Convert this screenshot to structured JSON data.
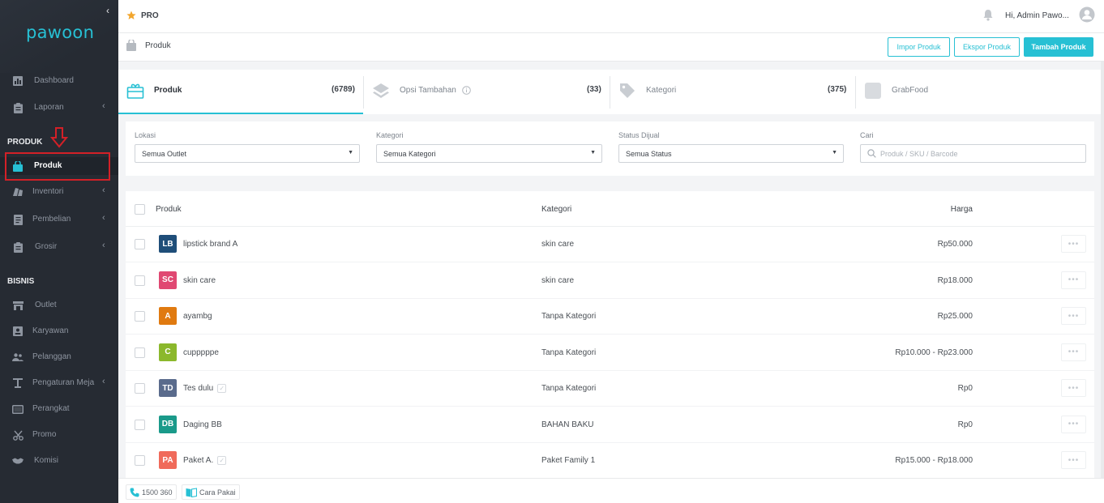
{
  "sidebar": {
    "logo": "pawoon",
    "items_top": [
      {
        "label": "Dashboard",
        "icon": "chart-icon",
        "chevron": false
      },
      {
        "label": "Laporan",
        "icon": "clipboard-icon",
        "chevron": true
      }
    ],
    "section_produk": "PRODUK",
    "produk_items": [
      {
        "label": "Produk",
        "icon": "bag-icon",
        "chevron": false,
        "active": true
      },
      {
        "label": "Inventori",
        "icon": "boxes-icon",
        "chevron": true
      },
      {
        "label": "Pembelian",
        "icon": "document-icon",
        "chevron": true
      },
      {
        "label": "Grosir",
        "icon": "clipboard-icon",
        "chevron": true
      }
    ],
    "section_bisnis": "BISNIS",
    "bisnis_items": [
      {
        "label": "Outlet",
        "icon": "store-icon",
        "chevron": false
      },
      {
        "label": "Karyawan",
        "icon": "id-card-icon",
        "chevron": false
      },
      {
        "label": "Pelanggan",
        "icon": "users-icon",
        "chevron": false
      },
      {
        "label": "Pengaturan Meja",
        "icon": "table-icon",
        "chevron": true
      },
      {
        "label": "Perangkat",
        "icon": "tablet-icon",
        "chevron": false
      },
      {
        "label": "Promo",
        "icon": "scissors-icon",
        "chevron": false
      },
      {
        "label": "Komisi",
        "icon": "handshake-icon",
        "chevron": false
      }
    ]
  },
  "topbar": {
    "plan": "PRO",
    "greeting": "Hi, Admin Pawo..."
  },
  "header": {
    "title": "Produk",
    "import_label": "Impor Produk",
    "export_label": "Ekspor Produk",
    "add_label": "Tambah Produk"
  },
  "tabs": [
    {
      "label": "Produk",
      "count": "(6789)"
    },
    {
      "label": "Opsi Tambahan",
      "count": "(33)"
    },
    {
      "label": "Kategori",
      "count": "(375)"
    },
    {
      "label": "GrabFood",
      "count": ""
    }
  ],
  "filters": {
    "lokasi_label": "Lokasi",
    "lokasi_value": "Semua Outlet",
    "kategori_label": "Kategori",
    "kategori_value": "Semua Kategori",
    "status_label": "Status Dijual",
    "status_value": "Semua Status",
    "cari_label": "Cari",
    "cari_placeholder": "Produk / SKU / Barcode"
  },
  "table": {
    "headers": {
      "produk": "Produk",
      "kategori": "Kategori",
      "harga": "Harga"
    },
    "rows": [
      {
        "initials": "LB",
        "color": "#1f4e79",
        "name": "lipstick brand A",
        "category": "skin care",
        "price": "Rp50.000",
        "check": false
      },
      {
        "initials": "SC",
        "color": "#e04872",
        "name": "skin care",
        "category": "skin care",
        "price": "Rp18.000",
        "check": false
      },
      {
        "initials": "A",
        "color": "#e07a10",
        "name": "ayambg",
        "category": "Tanpa Kategori",
        "price": "Rp25.000",
        "check": false
      },
      {
        "initials": "C",
        "color": "#8bb82c",
        "name": "cupppppe",
        "category": "Tanpa Kategori",
        "price": "Rp10.000 - Rp23.000",
        "check": false
      },
      {
        "initials": "TD",
        "color": "#5a6b8c",
        "name": "Tes dulu",
        "category": "Tanpa Kategori",
        "price": "Rp0",
        "check": true
      },
      {
        "initials": "DB",
        "color": "#1a9a8a",
        "name": "Daging BB",
        "category": "BAHAN BAKU",
        "price": "Rp0",
        "check": false
      },
      {
        "initials": "PA",
        "color": "#f06a5a",
        "name": "Paket A.",
        "category": "Paket Family 1",
        "price": "Rp15.000 - Rp18.000",
        "check": true
      }
    ]
  },
  "footer": {
    "phone": "1500 360",
    "guide": "Cara Pakai"
  },
  "colors": {
    "accent": "#27c0d4",
    "sidebar": "#262b33",
    "highlight": "#d32027"
  }
}
